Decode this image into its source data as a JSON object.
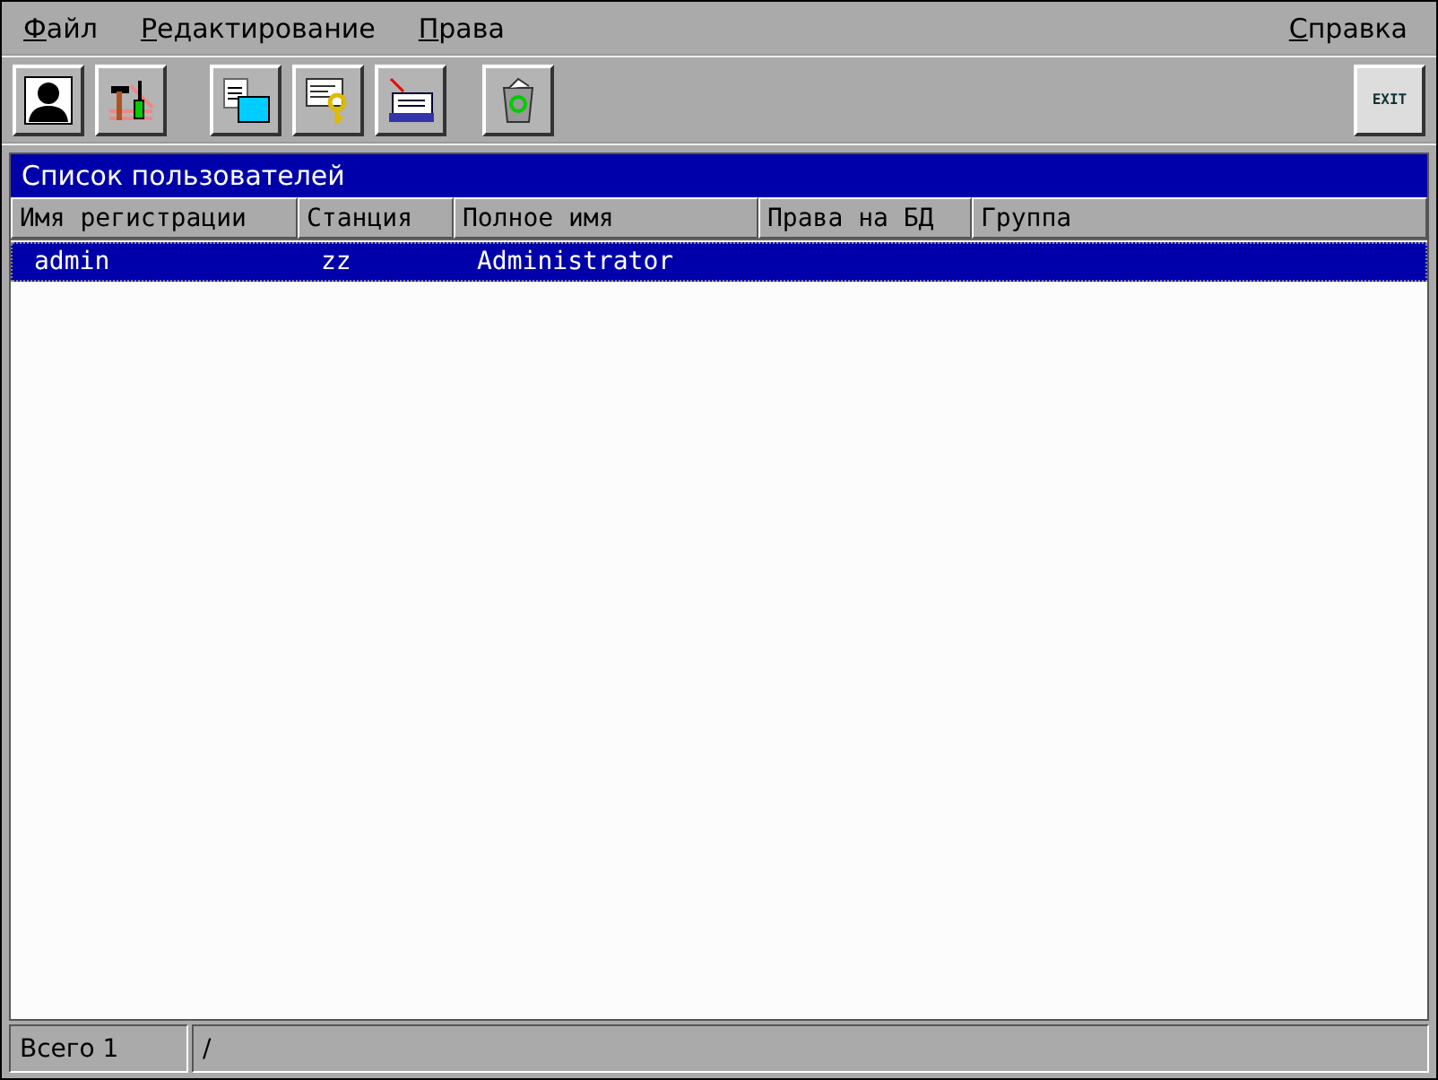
{
  "menu": {
    "left": [
      "Файл",
      "Редактирование",
      "Права"
    ],
    "right": [
      "Справка"
    ]
  },
  "toolbar": {
    "groups": [
      [
        {
          "kind": "user"
        },
        {
          "kind": "tools"
        }
      ],
      [
        {
          "kind": "rename"
        },
        {
          "kind": "key"
        },
        {
          "kind": "cards"
        }
      ],
      [
        {
          "kind": "trash"
        }
      ]
    ],
    "exit": {
      "label": "EXIT"
    }
  },
  "panel": {
    "title": "Список пользователей"
  },
  "table": {
    "columns": [
      "Имя регистрации",
      "Станция",
      "Полное имя",
      "Права на БД",
      "Группа"
    ],
    "rows": [
      {
        "cells": [
          "admin",
          "zz",
          "Administrator",
          "",
          ""
        ],
        "selected": true
      }
    ]
  },
  "status_bar": [
    "Всего 1",
    "/"
  ]
}
